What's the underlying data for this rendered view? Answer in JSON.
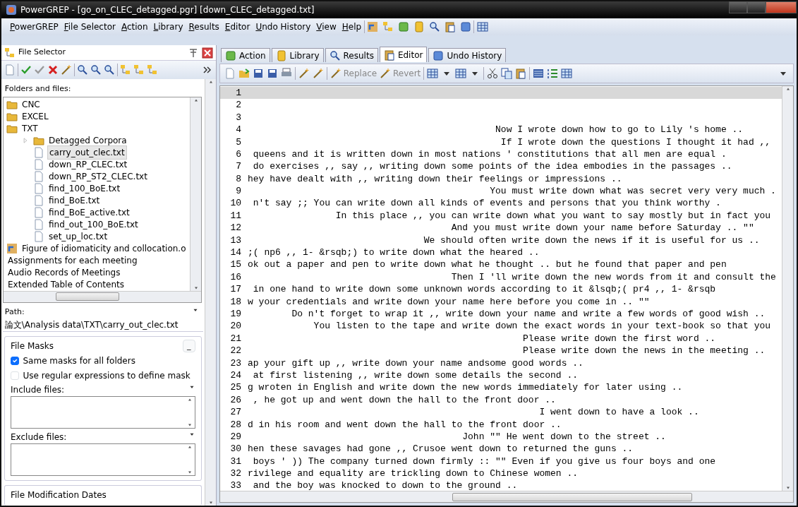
{
  "window": {
    "title": "PowerGREP - [go_on_CLEC_detagged.pgr] [down_CLEC_detagged.txt]"
  },
  "menu": [
    "PowerGREP",
    "File Selector",
    "Action",
    "Library",
    "Results",
    "Editor",
    "Undo History",
    "View",
    "Help"
  ],
  "file_selector": {
    "title": "File Selector",
    "folders_label": "Folders and files:",
    "tree": [
      {
        "label": "CNC",
        "kind": "folder",
        "selected": false
      },
      {
        "label": "EXCEL",
        "kind": "folder",
        "selected": false
      },
      {
        "label": "TXT",
        "kind": "folder",
        "selected": false,
        "children": [
          {
            "label": "Detagged Corpora",
            "kind": "folder",
            "selected": false,
            "expanded": false
          },
          {
            "label": "carry_out_clec.txt",
            "kind": "file",
            "selected": true
          },
          {
            "label": "down_RP_CLEC.txt",
            "kind": "file",
            "selected": false
          },
          {
            "label": "down_RP_ST2_CLEC.txt",
            "kind": "file",
            "selected": false
          },
          {
            "label": "find_100_BoE.txt",
            "kind": "file",
            "selected": false
          },
          {
            "label": "find_BoE.txt",
            "kind": "file",
            "selected": false
          },
          {
            "label": "find_BoE_active.txt",
            "kind": "file",
            "selected": false
          },
          {
            "label": "find_out_100_BoE.txt",
            "kind": "file",
            "selected": false
          },
          {
            "label": "set_up_loc.txt",
            "kind": "file",
            "selected": false
          }
        ]
      },
      {
        "label": "Figure of idiomaticity and collocation.o",
        "kind": "shortcut",
        "selected": false
      },
      {
        "label": "Assignments for each meeting",
        "kind": "plain",
        "selected": false
      },
      {
        "label": "Audio Records of Meetings",
        "kind": "plain",
        "selected": false
      },
      {
        "label": "Extended Table of Contents",
        "kind": "plain",
        "selected": false
      }
    ],
    "path_label": "Path:",
    "path": "論文\\Analysis data\\TXT\\carry_out_clec.txt",
    "file_masks": {
      "title": "File Masks",
      "collapse_button": "_",
      "options": [
        {
          "label": "Same masks for all folders",
          "checked": true
        },
        {
          "label": "Use regular expressions to define mask",
          "checked": false
        }
      ],
      "include_label": "Include files:",
      "exclude_label": "Exclude files:"
    },
    "dates_title": "File Modification Dates"
  },
  "tabs": [
    {
      "label": "Action",
      "selected": false
    },
    {
      "label": "Library",
      "selected": false
    },
    {
      "label": "Results",
      "selected": false
    },
    {
      "label": "Editor",
      "selected": true
    },
    {
      "label": "Undo History",
      "selected": false
    }
  ],
  "editor_toolbar": {
    "replace": "Replace",
    "revert": "Revert"
  },
  "editor": {
    "lines": [
      {
        "number": "1",
        "current": true
      },
      {
        "number": "2",
        "current": false
      },
      {
        "number": "3",
        "current": false
      },
      {
        "number": "4",
        "current": false,
        "text": "                                             Now I wrote down how to go to Lily 's home .."
      },
      {
        "number": "5",
        "current": false,
        "text": "                                              If I wrote down the questions I thought it had ,,"
      },
      {
        "number": "6",
        "current": false,
        "text": " queens and it is written down in most nations ' constitutions that all men are equal ."
      },
      {
        "number": "7",
        "current": false,
        "text": " do exercises ,, say ,, writing down some points of the idea embodies in the passages .."
      },
      {
        "number": "8",
        "current": false,
        "text": "hey have dealt with ,, writing down their feelings or impressions .."
      },
      {
        "number": "9",
        "current": false,
        "text": "                                            You must write down what was secret very very much ."
      },
      {
        "number": "10",
        "current": false,
        "text": " n't say ;; You can write down all kinds of events and persons that you think worthy ."
      },
      {
        "number": "11",
        "current": false,
        "text": "                In this place ,, you can write down what you want to say mostly but in fact you"
      },
      {
        "number": "12",
        "current": false,
        "text": "                                     And you must write down your name before Saturday .. \"\""
      },
      {
        "number": "13",
        "current": false,
        "text": "                                We should often write down the news if it is useful for us .."
      },
      {
        "number": "14",
        "current": false,
        "text": ";( np6 ,, 1- &rsqb;) to write down what the heared .."
      },
      {
        "number": "15",
        "current": false,
        "text": "ok out a paper and pen to write down what he thought .. but he found that paper and pen"
      },
      {
        "number": "16",
        "current": false,
        "text": "                                     Then I 'll write down the new words from it and consult the"
      },
      {
        "number": "17",
        "current": false,
        "text": " in one hand to write down some unknown words according to it &lsqb;( pr4 ,, 1- &rsqb"
      },
      {
        "number": "18",
        "current": false,
        "text": "w your credentials and write down your name here before you come in .. \"\""
      },
      {
        "number": "19",
        "current": false,
        "text": "        Do n't forget to wrap it ,, write down your name and write a few words of good wish .."
      },
      {
        "number": "20",
        "current": false,
        "text": "            You listen to the tape and write down the exact words in your text-book so that you"
      },
      {
        "number": "21",
        "current": false,
        "text": "                                                  Please write down the first word .."
      },
      {
        "number": "22",
        "current": false,
        "text": "                                                  Please write down the news in the meeting .."
      },
      {
        "number": "23",
        "current": false,
        "text": "ap your gift up ,, write down your name andsome good words .."
      },
      {
        "number": "24",
        "current": false,
        "text": " at first listening ,, write down some details the second .."
      },
      {
        "number": "25",
        "current": false,
        "text": "g wroten in English and write down the new words immediately for later using .."
      },
      {
        "number": "26",
        "current": false,
        "text": " , he got up and went down the hall to the front door .."
      },
      {
        "number": "27",
        "current": false,
        "text": "                                                     I went down to have a look .."
      },
      {
        "number": "28",
        "current": false,
        "text": "d in his room and went down the hall to the front door .."
      },
      {
        "number": "29",
        "current": false,
        "text": "                                       John \"\" He went down to the street .."
      },
      {
        "number": "30",
        "current": false,
        "text": "hen these savages had gone ,, Crusoe went down to returned the guns .."
      },
      {
        "number": "31",
        "current": false,
        "text": " boys ' )) The company turned down firmly :: \"\" Even if you give us four boys and one"
      },
      {
        "number": "32",
        "current": false,
        "text": "rivilege and equality are trickling down to Chinese women .."
      },
      {
        "number": "33",
        "current": false,
        "text": " and the boy was knocked to down to the ground .."
      }
    ]
  }
}
